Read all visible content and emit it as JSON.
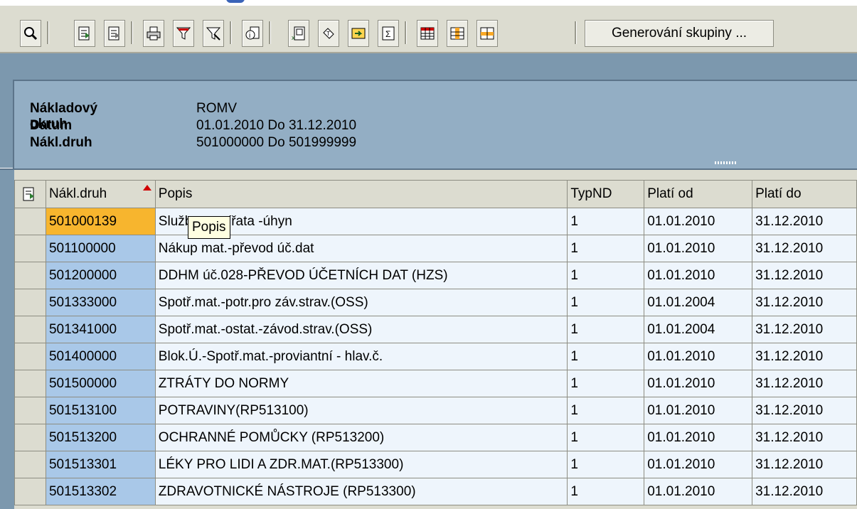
{
  "toolbar": {
    "icons": [
      "details-icon",
      "select-all-icon",
      "deselect-all-icon",
      "print-icon",
      "filter-icon",
      "delete-filter-icon",
      "info-icon",
      "export-excel-icon",
      "sort-icon",
      "transfer-icon",
      "totals-icon",
      "layout-icon",
      "insert-column-icon",
      "choose-layout-icon"
    ],
    "generate_group_label": "Generování skupiny ..."
  },
  "header": {
    "fields": [
      {
        "label": "Nákladový okruh",
        "value": "ROMV"
      },
      {
        "label": "Datum",
        "value": "01.01.2010 Do 31.12.2010"
      },
      {
        "label": "Nákl.druh",
        "value": "501000000 Do 501999999"
      }
    ]
  },
  "table": {
    "columns": [
      "Nákl.druh",
      "Popis",
      "TypND",
      "Platí od",
      "Platí do"
    ],
    "rows": [
      {
        "code": "501000139",
        "popis": "Služby – zvířata -úhyn",
        "typ": "1",
        "od": "01.01.2010",
        "do": "31.12.2010"
      },
      {
        "code": "501100000",
        "popis": "Nákup mat.-převod úč.dat",
        "typ": "1",
        "od": "01.01.2010",
        "do": "31.12.2010"
      },
      {
        "code": "501200000",
        "popis": "DDHM úč.028-PŘEVOD ÚČETNÍCH DAT (HZS)",
        "typ": "1",
        "od": "01.01.2010",
        "do": "31.12.2010"
      },
      {
        "code": "501333000",
        "popis": "Spotř.mat.-potr.pro záv.strav.(OSS)",
        "typ": "1",
        "od": "01.01.2004",
        "do": "31.12.2010"
      },
      {
        "code": "501341000",
        "popis": "Spotř.mat.-ostat.-závod.strav.(OSS)",
        "typ": "1",
        "od": "01.01.2004",
        "do": "31.12.2010"
      },
      {
        "code": "501400000",
        "popis": "Blok.Ú.-Spotř.mat.-proviantní - hlav.č.",
        "typ": "1",
        "od": "01.01.2010",
        "do": "31.12.2010"
      },
      {
        "code": "501500000",
        "popis": "ZTRÁTY DO NORMY",
        "typ": "1",
        "od": "01.01.2010",
        "do": "31.12.2010"
      },
      {
        "code": "501513100",
        "popis": "POTRAVINY(RP513100)",
        "typ": "1",
        "od": "01.01.2010",
        "do": "31.12.2010"
      },
      {
        "code": "501513200",
        "popis": "OCHRANNÉ POMŮCKY (RP513200)",
        "typ": "1",
        "od": "01.01.2010",
        "do": "31.12.2010"
      },
      {
        "code": "501513301",
        "popis": "LÉKY PRO LIDI A ZDR.MAT.(RP513300)",
        "typ": "1",
        "od": "01.01.2010",
        "do": "31.12.2010"
      },
      {
        "code": "501513302",
        "popis": "ZDRAVOTNICKÉ NÁSTROJE (RP513300)",
        "typ": "1",
        "od": "01.01.2010",
        "do": "31.12.2010"
      }
    ]
  },
  "tooltip": {
    "text": "Popis"
  },
  "colors": {
    "toolbar": "#dcdcd0",
    "header_panel": "#93aec4",
    "key_cell": "#a9c8e8",
    "active_cell": "#f7b52e"
  }
}
